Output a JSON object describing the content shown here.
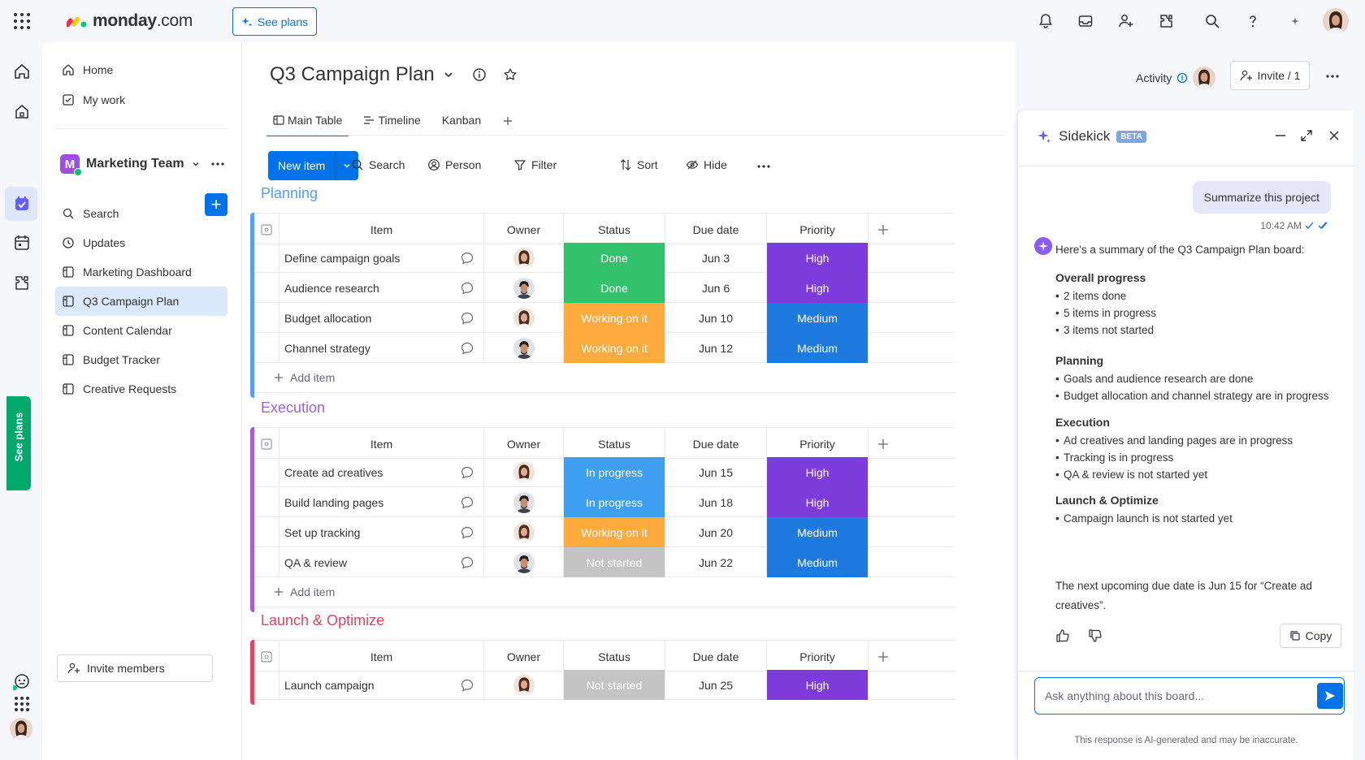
{
  "topbar": {
    "logo_brand": "monday",
    "logo_suffix": ".com",
    "see_plans": "See plans"
  },
  "rail": {
    "see_plans_vertical": "See plans"
  },
  "sidebar": {
    "top_items": [
      {
        "label": "Home",
        "icon": "home-icon"
      },
      {
        "label": "My work",
        "icon": "my-work-icon"
      }
    ],
    "workspace": {
      "badge": "M",
      "name": "Marketing Team"
    },
    "items": [
      {
        "label": "Search",
        "icon": "search-icon"
      },
      {
        "label": "Updates",
        "icon": "updates-icon"
      },
      {
        "label": "Marketing Dashboard",
        "icon": "board-icon"
      },
      {
        "label": "Q3 Campaign Plan",
        "icon": "board-icon",
        "active": true
      },
      {
        "label": "Content Calendar",
        "icon": "board-icon"
      },
      {
        "label": "Budget Tracker",
        "icon": "board-icon"
      },
      {
        "label": "Creative Requests",
        "icon": "board-icon"
      }
    ],
    "invite_members": "Invite members"
  },
  "board": {
    "title": "Q3 Campaign Plan",
    "activity_label": "Activity",
    "invite_label": "Invite / 1",
    "tabs": [
      {
        "label": "Main Table",
        "active": true
      },
      {
        "label": "Timeline"
      },
      {
        "label": "Kanban"
      }
    ],
    "toolbar": {
      "new_item": "New item",
      "search": "Search",
      "person": "Person",
      "filter": "Filter",
      "sort": "Sort",
      "hide": "Hide"
    },
    "columns": [
      "Item",
      "Owner",
      "Status",
      "Due date",
      "Priority"
    ],
    "add_item": "Add item",
    "groups": [
      {
        "name": "Planning",
        "color": "#579bfc",
        "rows": [
          {
            "item": "Define campaign goals",
            "owner": "woman",
            "status": "Done",
            "due": "Jun 3",
            "priority": "High"
          },
          {
            "item": "Audience research",
            "owner": "man",
            "status": "Done",
            "due": "Jun 6",
            "priority": "High"
          },
          {
            "item": "Budget allocation",
            "owner": "woman",
            "status": "Working on it",
            "due": "Jun 10",
            "priority": "Medium"
          },
          {
            "item": "Channel strategy",
            "owner": "man",
            "status": "Working on it",
            "due": "Jun 12",
            "priority": "Medium"
          }
        ]
      },
      {
        "name": "Execution",
        "color": "#a25ddc",
        "rows": [
          {
            "item": "Create ad creatives",
            "owner": "woman",
            "status": "In progress",
            "due": "Jun 15",
            "priority": "High"
          },
          {
            "item": "Build landing pages",
            "owner": "man",
            "status": "In progress",
            "due": "Jun 18",
            "priority": "High"
          },
          {
            "item": "Set up tracking",
            "owner": "woman",
            "status": "Working on it",
            "due": "Jun 20",
            "priority": "Medium"
          },
          {
            "item": "QA & review",
            "owner": "man",
            "status": "Not started",
            "due": "Jun 22",
            "priority": "Medium"
          }
        ]
      },
      {
        "name": "Launch & Optimize",
        "color": "#e2445c",
        "rows": [
          {
            "item": "Launch campaign",
            "owner": "woman",
            "status": "Not started",
            "due": "Jun 25",
            "priority": "High"
          }
        ]
      }
    ],
    "status_colors": {
      "Done": "#33c26b",
      "Working on it": "#fdab3d",
      "In progress": "#3f9ff0",
      "Not started": "#c4c4c4"
    },
    "priority_colors": {
      "High": "#7e3bdc",
      "Medium": "#1f7ae0"
    }
  },
  "sidekick": {
    "title": "Sidekick",
    "beta": "BETA",
    "user_message": "Summarize this project",
    "message_time": "10:42 AM",
    "intro": "Here's a summary of the Q3 Campaign Plan board:",
    "sections": [
      {
        "heading": "Overall progress",
        "bullets": [
          "2 items done",
          "5 items in progress",
          "3 items not started"
        ]
      },
      {
        "heading": "Planning",
        "bullets": [
          "Goals and audience research are done",
          "Budget allocation and channel strategy are in progress"
        ]
      },
      {
        "heading": "Execution",
        "bullets": [
          "Ad creatives and landing pages are in progress",
          "Tracking is in progress",
          "QA & review is not started yet"
        ]
      },
      {
        "heading": "Launch & Optimize",
        "bullets": [
          "Campaign launch is not started yet"
        ]
      }
    ],
    "closing_line1": "The next upcoming due date is Jun 15 for “Create ad",
    "closing_line2": "creatives”.",
    "copy": "Copy",
    "input_placeholder": "Ask anything about this board...",
    "disclaimer": "This response is AI-generated and may be inaccurate."
  }
}
